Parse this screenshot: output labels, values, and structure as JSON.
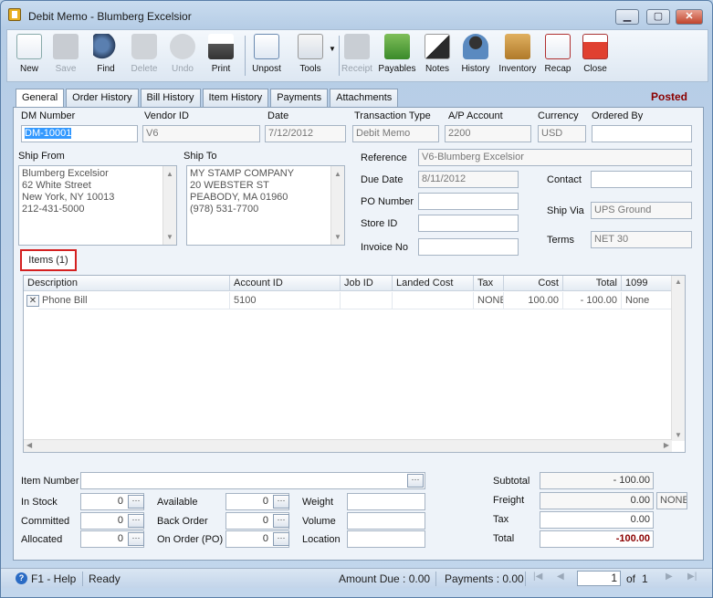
{
  "window": {
    "title": "Debit Memo - Blumberg Excelsior",
    "min": "▁",
    "max": "▢",
    "close": "✕"
  },
  "toolbar": {
    "new": "New",
    "save": "Save",
    "find": "Find",
    "delete": "Delete",
    "undo": "Undo",
    "print": "Print",
    "unpost": "Unpost",
    "tools": "Tools",
    "receipt": "Receipt",
    "payables": "Payables",
    "notes": "Notes",
    "history": "History",
    "inventory": "Inventory",
    "recap": "Recap",
    "close": "Close"
  },
  "tabs": [
    "General",
    "Order History",
    "Bill History",
    "Item History",
    "Payments",
    "Attachments"
  ],
  "status_label": "Posted",
  "header": {
    "dm_number_label": "DM Number",
    "dm_number": "DM-10001",
    "vendor_id_label": "Vendor ID",
    "vendor_id": "V6",
    "date_label": "Date",
    "date": "7/12/2012",
    "transaction_type_label": "Transaction Type",
    "transaction_type": "Debit Memo",
    "ap_account_label": "A/P Account",
    "ap_account": "2200",
    "currency_label": "Currency",
    "currency": "USD",
    "ordered_by_label": "Ordered By",
    "ordered_by": ""
  },
  "ship_from": {
    "label": "Ship From",
    "line1": "Blumberg Excelsior",
    "line2": "62 White Street",
    "line3": "New York, NY 10013",
    "line4": "212-431-5000"
  },
  "ship_to": {
    "label": "Ship To",
    "line1": "MY STAMP COMPANY",
    "line2": "20 WEBSTER ST",
    "line3": "PEABODY, MA 01960",
    "line4": "(978) 531-7700"
  },
  "details": {
    "reference_label": "Reference",
    "reference": "V6-Blumberg Excelsior",
    "due_date_label": "Due Date",
    "due_date": "8/11/2012",
    "po_number_label": "PO Number",
    "po_number": "",
    "store_id_label": "Store ID",
    "store_id": "",
    "invoice_no_label": "Invoice No",
    "invoice_no": "",
    "contact_label": "Contact",
    "contact": "",
    "ship_via_label": "Ship Via",
    "ship_via": "UPS Ground",
    "terms_label": "Terms",
    "terms": "NET 30"
  },
  "items_tab": "Items (1)",
  "grid": {
    "columns": [
      "Description",
      "Account ID",
      "Job ID",
      "Landed Cost",
      "Tax",
      "Cost",
      "Total",
      "1099"
    ],
    "rows": [
      {
        "description": "Phone Bill",
        "account_id": "5100",
        "job_id": "",
        "landed_cost": "",
        "tax": "NONE",
        "cost": "100.00",
        "total": "- 100.00",
        "f1099": "None"
      }
    ]
  },
  "footer": {
    "item_number_label": "Item Number",
    "in_stock_label": "In Stock",
    "in_stock": "0",
    "committed_label": "Committed",
    "committed": "0",
    "allocated_label": "Allocated",
    "allocated": "0",
    "available_label": "Available",
    "available": "0",
    "back_order_label": "Back Order",
    "back_order": "0",
    "on_order_label": "On Order (PO)",
    "on_order": "0",
    "weight_label": "Weight",
    "volume_label": "Volume",
    "location_label": "Location",
    "ellipsis": "···"
  },
  "totals": {
    "subtotal_label": "Subtotal",
    "subtotal": "- 100.00",
    "freight_label": "Freight",
    "freight": "0.00",
    "freight_tax": "NONE",
    "tax_label": "Tax",
    "tax": "0.00",
    "total_label": "Total",
    "total": "-100.00"
  },
  "statusbar": {
    "help": "F1 - Help",
    "status": "Ready",
    "amount_due": "Amount Due : 0.00",
    "payments": "Payments : 0.00",
    "page": "1",
    "of": "of",
    "total_pages": "1"
  }
}
